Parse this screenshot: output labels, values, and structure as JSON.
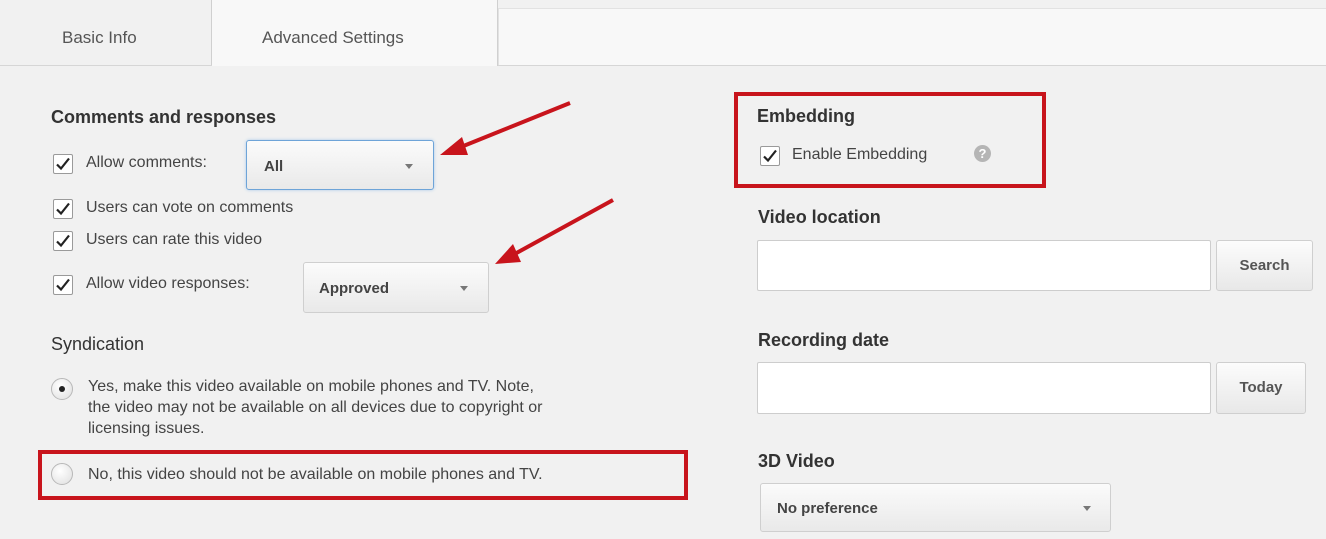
{
  "tabs": [
    {
      "label": "Basic Info"
    },
    {
      "label": "Advanced Settings"
    }
  ],
  "comments": {
    "title": "Comments and responses",
    "allow_comments_label": "Allow comments:",
    "allow_comments_value": "All",
    "vote_label": "Users can vote on comments",
    "rate_label": "Users can rate this video",
    "responses_label": "Allow video responses:",
    "responses_value": "Approved"
  },
  "syndication": {
    "title": "Syndication",
    "yes_label": "Yes, make this video available on mobile phones and TV. Note, the video may not be available on all devices due to copyright or licensing issues.",
    "yes_line1": "Yes, make this video available on mobile phones and TV. Note,",
    "yes_line2": "the video may not be available on all devices due to copyright or",
    "yes_line3": "licensing issues.",
    "no_label": "No, this video should not be available on mobile phones and TV.",
    "selected": "yes"
  },
  "embedding": {
    "title": "Embedding",
    "enable_label": "Enable Embedding",
    "help_glyph": "?"
  },
  "location": {
    "title": "Video location",
    "value": "",
    "search_label": "Search"
  },
  "recording": {
    "title": "Recording date",
    "value": "",
    "today_label": "Today"
  },
  "video3d": {
    "title": "3D Video",
    "value": "No preference"
  },
  "colors": {
    "highlight": "#c8141c",
    "arrow": "#c8141c",
    "focus": "#6ea4d8"
  }
}
